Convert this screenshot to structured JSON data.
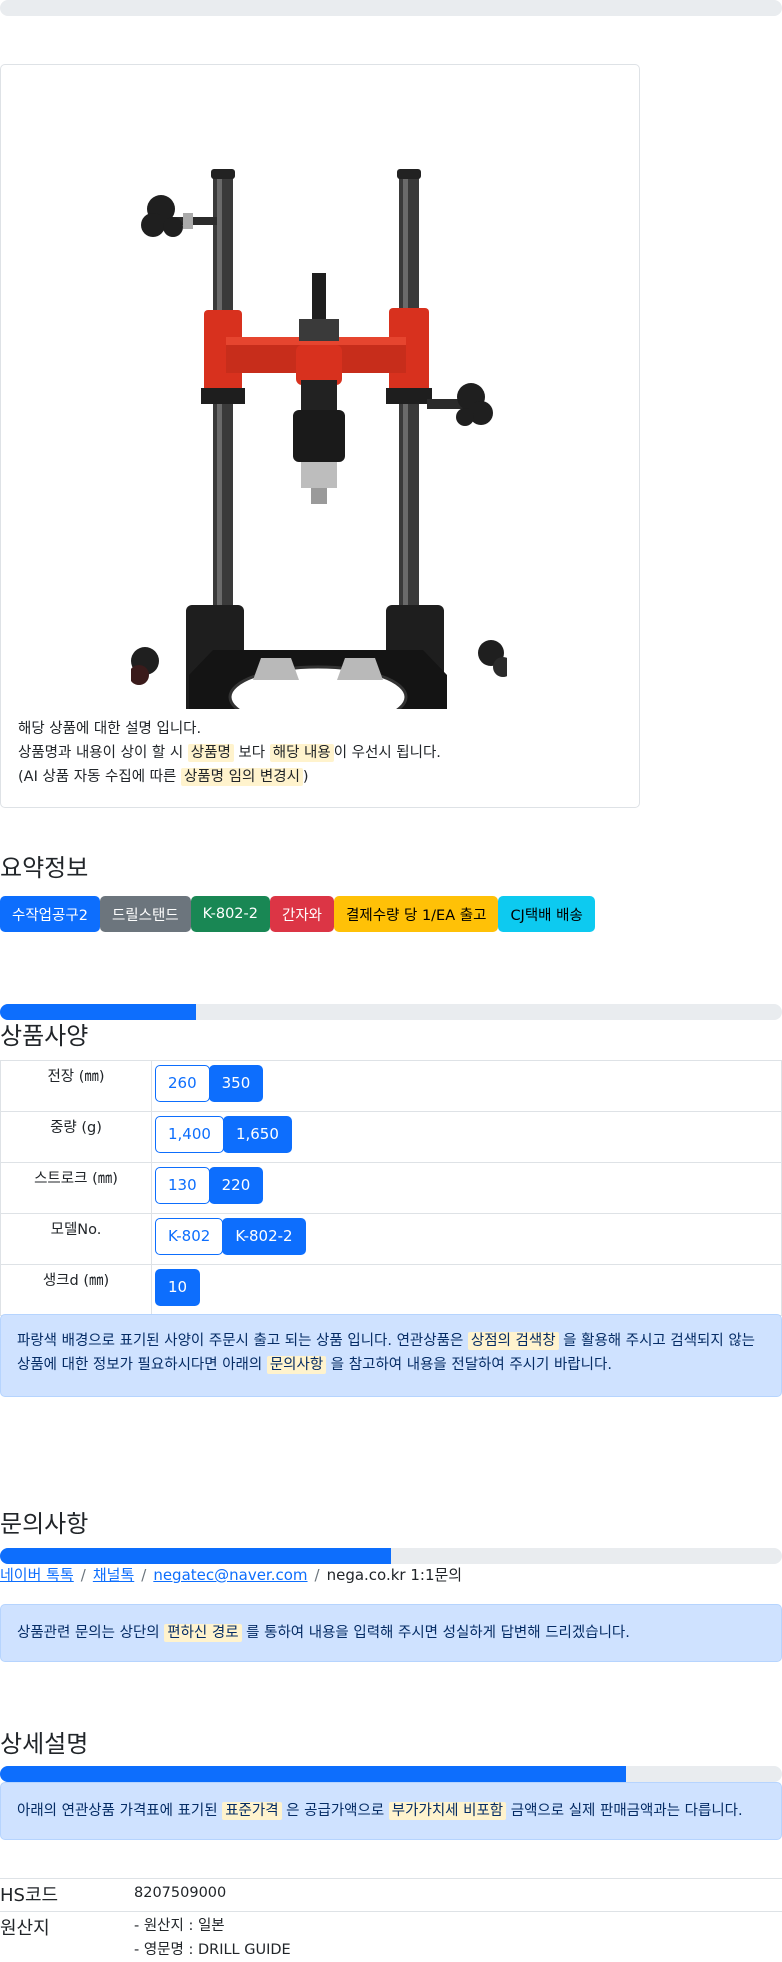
{
  "card": {
    "image_name": "K-802-2 drill stand",
    "line1": "해당 상품에 대한 설명 입니다.",
    "line2": {
      "pre": "상품명과 내용이 상이 할 시 ",
      "hl1": "상품명",
      "mid": " 보다 ",
      "hl2": "해당 내용",
      "post": "이 우선시 됩니다."
    },
    "line3": {
      "pre": "(AI 상품 자동 수집에 따른 ",
      "hl": "상품명 임의 변경시",
      "post": ")"
    }
  },
  "summary": {
    "title": "요약정보",
    "badges": [
      {
        "label": "수작업공구2",
        "bg": "#0d6efd",
        "fg": "#ffffff"
      },
      {
        "label": "드릴스탠드",
        "bg": "#6c757d",
        "fg": "#ffffff"
      },
      {
        "label": "K-802-2",
        "bg": "#198754",
        "fg": "#ffffff"
      },
      {
        "label": "간자와",
        "bg": "#dc3545",
        "fg": "#ffffff"
      },
      {
        "label": "결제수량 당 1/EA 출고",
        "bg": "#ffc107",
        "fg": "#000000"
      },
      {
        "label": "CJ택배 배송",
        "bg": "#0dcaf0",
        "fg": "#000000"
      }
    ]
  },
  "specs": {
    "title": "상품사양",
    "progress": 0.25,
    "rows": [
      {
        "label": "전장 (㎜)",
        "options": [
          {
            "v": "260",
            "sel": false
          },
          {
            "v": "350",
            "sel": true
          }
        ]
      },
      {
        "label": "중량 (g)",
        "options": [
          {
            "v": "1,400",
            "sel": false
          },
          {
            "v": "1,650",
            "sel": true
          }
        ]
      },
      {
        "label": "스트로크 (㎜)",
        "options": [
          {
            "v": "130",
            "sel": false
          },
          {
            "v": "220",
            "sel": true
          }
        ]
      },
      {
        "label": "모델No.",
        "options": [
          {
            "v": "K-802",
            "sel": false
          },
          {
            "v": "K-802-2",
            "sel": true
          }
        ]
      },
      {
        "label": "생크d (㎜)",
        "options": [
          {
            "v": "10",
            "sel": true
          }
        ]
      }
    ],
    "notice": {
      "pre": "파랑색 배경으로 표기된 사양이 주문시 출고 되는 상품 입니다. 연관상품은 ",
      "hl1": "상점의 검색창",
      "mid": " 을 활용해 주시고 검색되지 않는 상품에 대한 정보가 필요하시다면 아래의 ",
      "hl2": "문의사항",
      "post": " 을 참고하여 내용을 전달하여 주시기 바랍니다."
    }
  },
  "inquiry": {
    "title": "문의사항",
    "progress": 0.5,
    "links": [
      "네이버 톡톡",
      "채널톡",
      "negatec@naver.com"
    ],
    "plain": "nega.co.kr 1:1문의",
    "notice": {
      "pre": "상품관련 문의는 상단의 ",
      "hl": "편하신 경로",
      "post": " 를 통하여 내용을 입력해 주시면 성실하게 답변해 드리겠습니다."
    }
  },
  "detail": {
    "title": "상세설명",
    "progress": 0.8,
    "notice": {
      "pre": "아래의 연관상품 가격표에 표기된 ",
      "hl1": "표준가격",
      "mid": " 은 공급가액으로 ",
      "hl2": "부가가치세 비포함",
      "post": " 금액으로 실제 판매금액과는 다릅니다."
    },
    "hs_label": "HS코드",
    "hs_value": "8207509000",
    "origin_label": "원산지",
    "origin_line1": "- 원산지 : 일본",
    "origin_line2": "- 영문명 : DRILL GUIDE"
  }
}
